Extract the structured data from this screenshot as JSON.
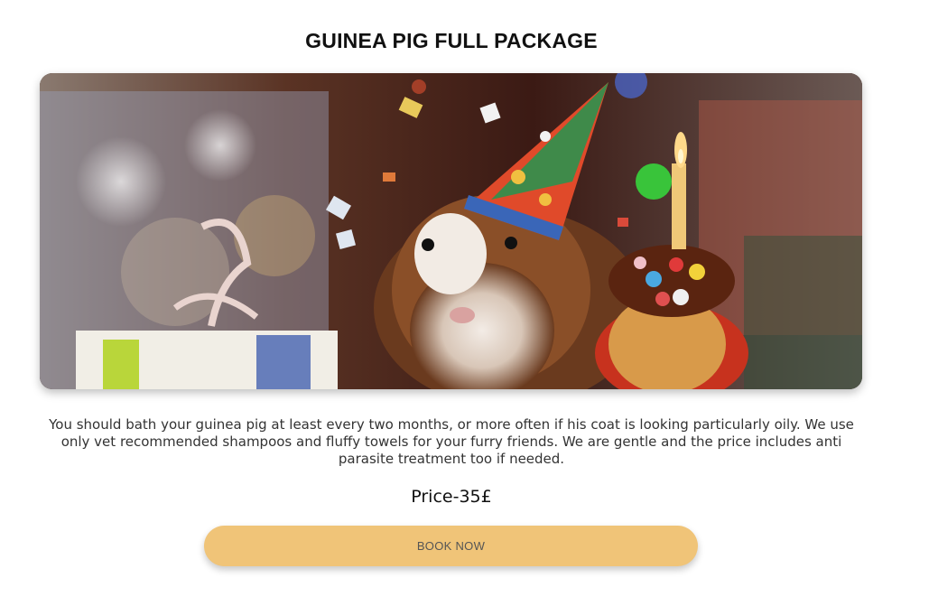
{
  "product": {
    "title": "GUINEA PIG FULL PACKAGE",
    "image_alt": "Guinea pig wearing a party hat next to a birthday cupcake with a candle",
    "description": "You should bath your guinea pig at least every two months, or more often if his coat is looking particularly oily. We use only vet recommended shampoos and fluffy towels for your furry friends. We are gentle and the price includes anti parasite treatment too if needed.",
    "price": "Price-35£",
    "book_label": "BOOK NOW"
  },
  "colors": {
    "button_bg": "#f0c478",
    "button_text": "#555555",
    "title_text": "#111111"
  }
}
